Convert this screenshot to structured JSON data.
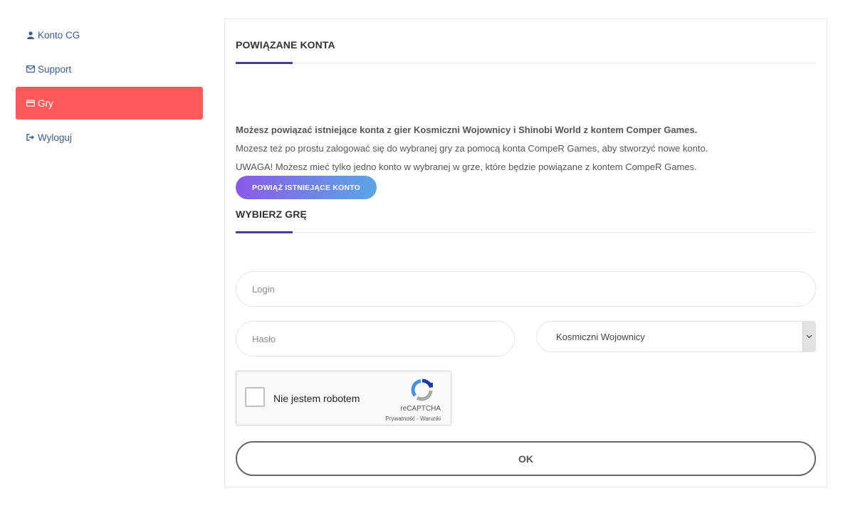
{
  "sidebar": {
    "items": [
      {
        "label": "Konto CG",
        "icon": "user-icon"
      },
      {
        "label": "Support",
        "icon": "envelope-icon"
      },
      {
        "label": "Gry",
        "icon": "credit-card-icon",
        "active": true
      },
      {
        "label": "Wyloguj",
        "icon": "sign-out-icon"
      }
    ]
  },
  "linked": {
    "title": "POWIĄZANE KONTA",
    "line1": "Możesz powiązać istniejące konta z gier Kosmiczni Wojownicy i Shinobi World z kontem Comper Games.",
    "line2": "Możesz też po prostu zalogować się do wybranej gry za pomocą konta CompeR Games, aby stworzyć nowe konto.",
    "line3": "UWAGA! Możesz mieć tylko jedno konto w wybranej w grze, które będzie powiązane z kontem CompeR Games.",
    "button_label": "POWIĄŻ ISTNIEJĄCE KONTO"
  },
  "game_form": {
    "title": "WYBIERZ GRĘ",
    "login_placeholder": "Login",
    "password_placeholder": "Hasło",
    "game_selected": "Kosmiczni Wojownicy",
    "captcha_label": "Nie jestem robotem",
    "captcha_brand": "reCAPTCHA",
    "captcha_terms": "Prywatność - Warunki",
    "submit_label": "OK"
  },
  "colors": {
    "active_item": "#ff5a5a",
    "link_text": "#3a5a8c",
    "accent_rule": "#4b3a9e",
    "button_gradient_start": "#8a5ae6",
    "button_gradient_end": "#5aa6e6"
  }
}
